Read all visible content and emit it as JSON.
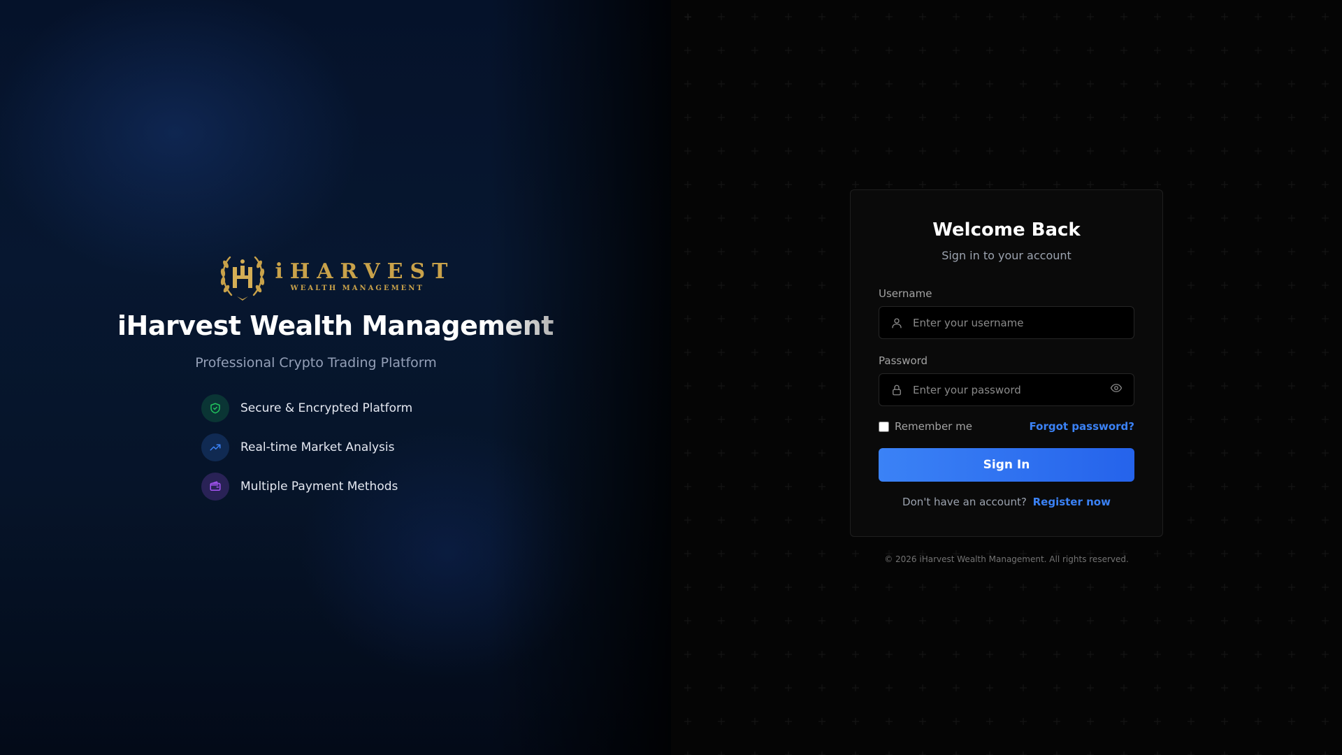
{
  "brand": {
    "logo_main": "iHARVEST",
    "logo_sub": "WEALTH MANAGEMENT",
    "title": "iHarvest Wealth Management",
    "subtitle": "Professional Crypto Trading Platform",
    "logo_color": "#c9a24a"
  },
  "features": [
    {
      "icon": "shield-check-icon",
      "label": "Secure & Encrypted Platform",
      "color": "#22c55e"
    },
    {
      "icon": "trending-up-icon",
      "label": "Real-time Market Analysis",
      "color": "#3b82f6"
    },
    {
      "icon": "wallet-icon",
      "label": "Multiple Payment Methods",
      "color": "#a855f7"
    }
  ],
  "login": {
    "title": "Welcome Back",
    "subtitle": "Sign in to your account",
    "username_label": "Username",
    "username_placeholder": "Enter your username",
    "username_value": "",
    "password_label": "Password",
    "password_placeholder": "Enter your password",
    "password_value": "",
    "remember_label": "Remember me",
    "remember_checked": false,
    "forgot_label": "Forgot password?",
    "signin_label": "Sign In",
    "register_prompt": "Don't have an account?",
    "register_label": "Register now",
    "accent_color": "#3b82f6"
  },
  "footer": {
    "copyright": "© 2026 iHarvest Wealth Management. All rights reserved."
  }
}
